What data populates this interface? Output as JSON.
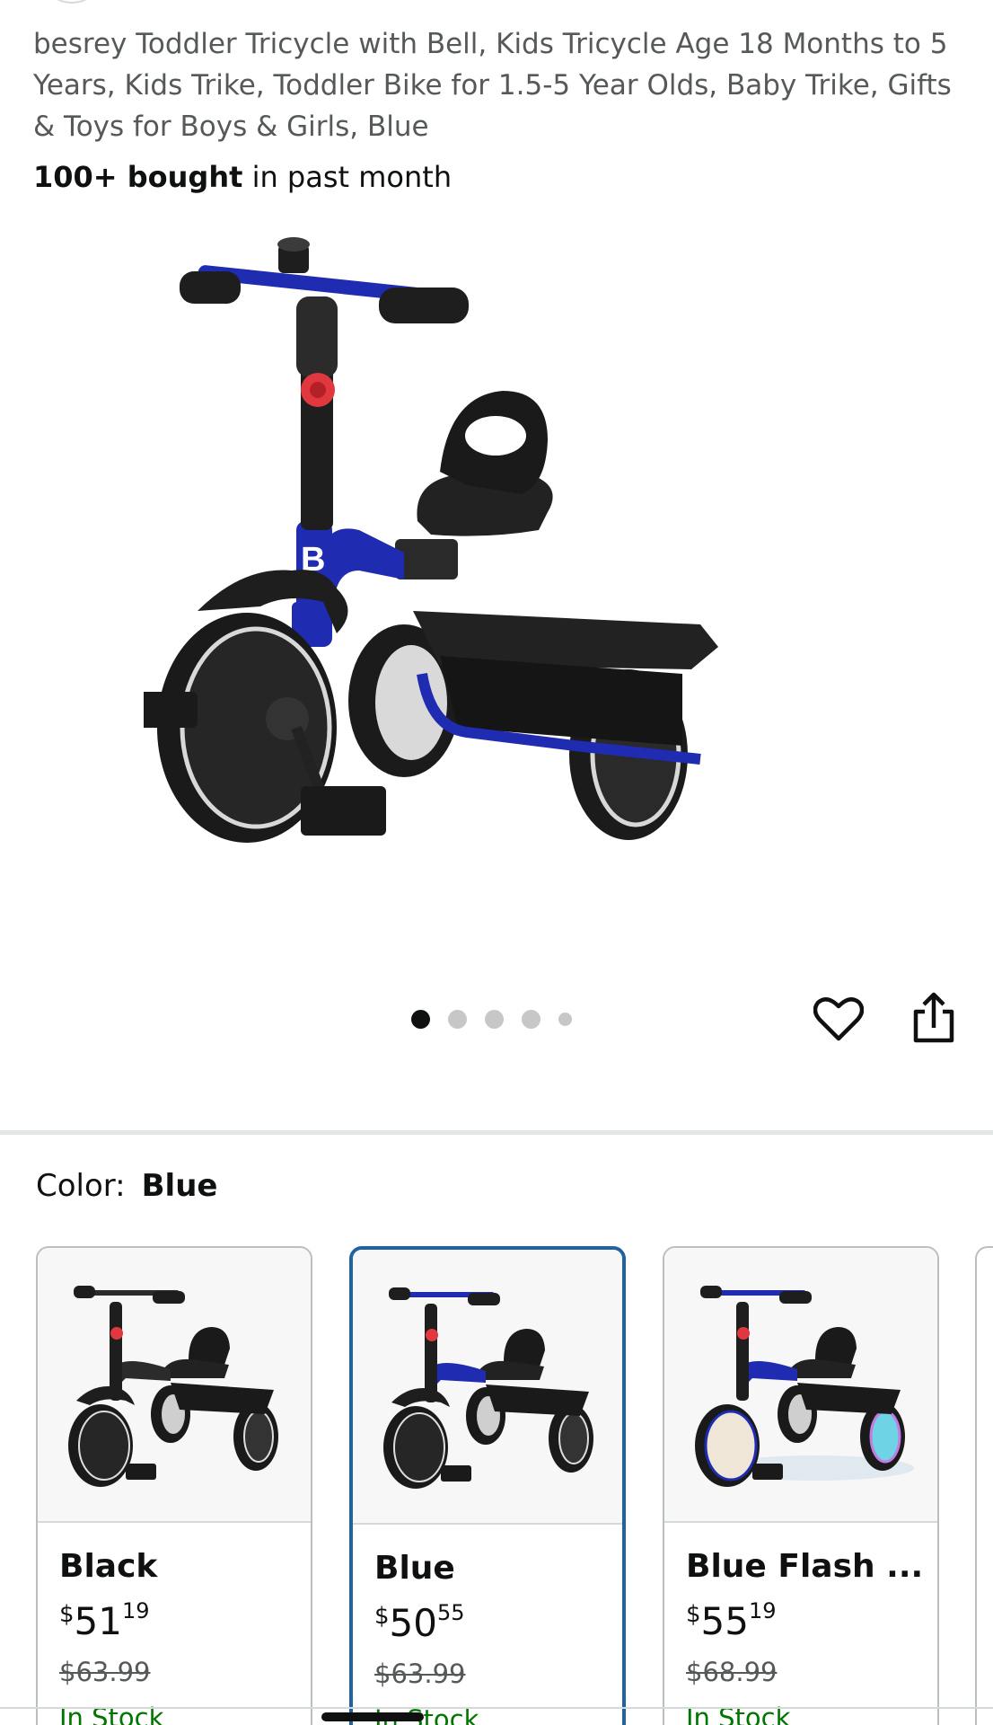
{
  "product": {
    "title": "besrey Toddler Tricycle with Bell, Kids Tricycle Age 18 Months to 5 Years, Kids Trike, Toddler Bike for 1.5-5 Year Olds, Baby Trike, Gifts & Toys for Boys & Girls, Blue",
    "bought_bold": "100+ bought",
    "bought_rest": " in past month"
  },
  "gallery": {
    "image_count": 5,
    "active_index": 0,
    "favorite_icon": "heart-outline-icon",
    "share_icon": "share-icon"
  },
  "color": {
    "label": "Color:",
    "selected": "Blue",
    "options": [
      {
        "name": "Black",
        "currency": "$",
        "whole": "51",
        "fraction": "19",
        "was": "$63.99",
        "stock": "In Stock",
        "frame_color": "#2b2b2b"
      },
      {
        "name": "Blue",
        "currency": "$",
        "whole": "50",
        "fraction": "55",
        "was": "$63.99",
        "stock": "In Stock",
        "frame_color": "#1f2bb0"
      },
      {
        "name": "Blue Flash ...",
        "currency": "$",
        "whole": "55",
        "fraction": "19",
        "was": "$68.99",
        "stock": "In Stock",
        "frame_color": "#1f2bb0"
      }
    ]
  },
  "colors": {
    "accent_blue": "#2162a1",
    "stock_green": "#007600",
    "trike_blue": "#1f2bb0"
  }
}
